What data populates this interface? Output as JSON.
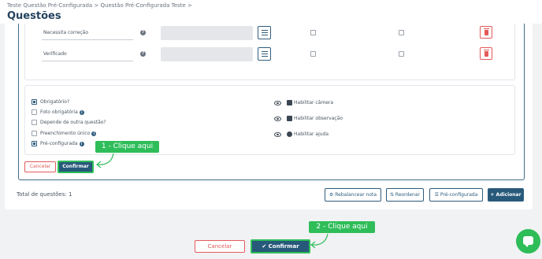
{
  "header": {
    "breadcrumb": "Teste Questão Pré-Configurada > Questão Pré-Configurada Teste >",
    "title": "Questões"
  },
  "question_rows": [
    {
      "label": "Necessita correção"
    },
    {
      "label": "Verificado"
    }
  ],
  "options": [
    {
      "label": "Obrigatório?",
      "checked": true,
      "info": false
    },
    {
      "label": "Foto obrigatória",
      "checked": false,
      "info": true
    },
    {
      "label": "Depende de outra questão?",
      "checked": false,
      "info": false
    },
    {
      "label": "Preenchimento único",
      "checked": false,
      "info": true
    },
    {
      "label": "Pré-configurada",
      "checked": true,
      "info": true
    }
  ],
  "habilitar": [
    {
      "label": "Habilitar câmera",
      "icon": "camera-icon"
    },
    {
      "label": "Habilitar observação",
      "icon": "note-icon"
    },
    {
      "label": "Habilitar ajuda",
      "icon": "info-icon"
    }
  ],
  "inner_buttons": {
    "cancel": "Cancelar",
    "confirm": "Confirmar"
  },
  "highlight_1": "1 - Clique aqui",
  "total_label": "Total de questões: 1",
  "actions": {
    "rebalance": "Rebalancear nota",
    "reorder": "Reordenar",
    "preconfig": "Pré-configurada",
    "add": "Adicionar"
  },
  "footer_buttons": {
    "cancel": "Cancelar",
    "confirm": "Confirmar"
  },
  "highlight_2": "2 - Clique aqui",
  "colors": {
    "primary": "#27597a",
    "danger": "#e45a5a",
    "highlight": "#2ebd59"
  }
}
